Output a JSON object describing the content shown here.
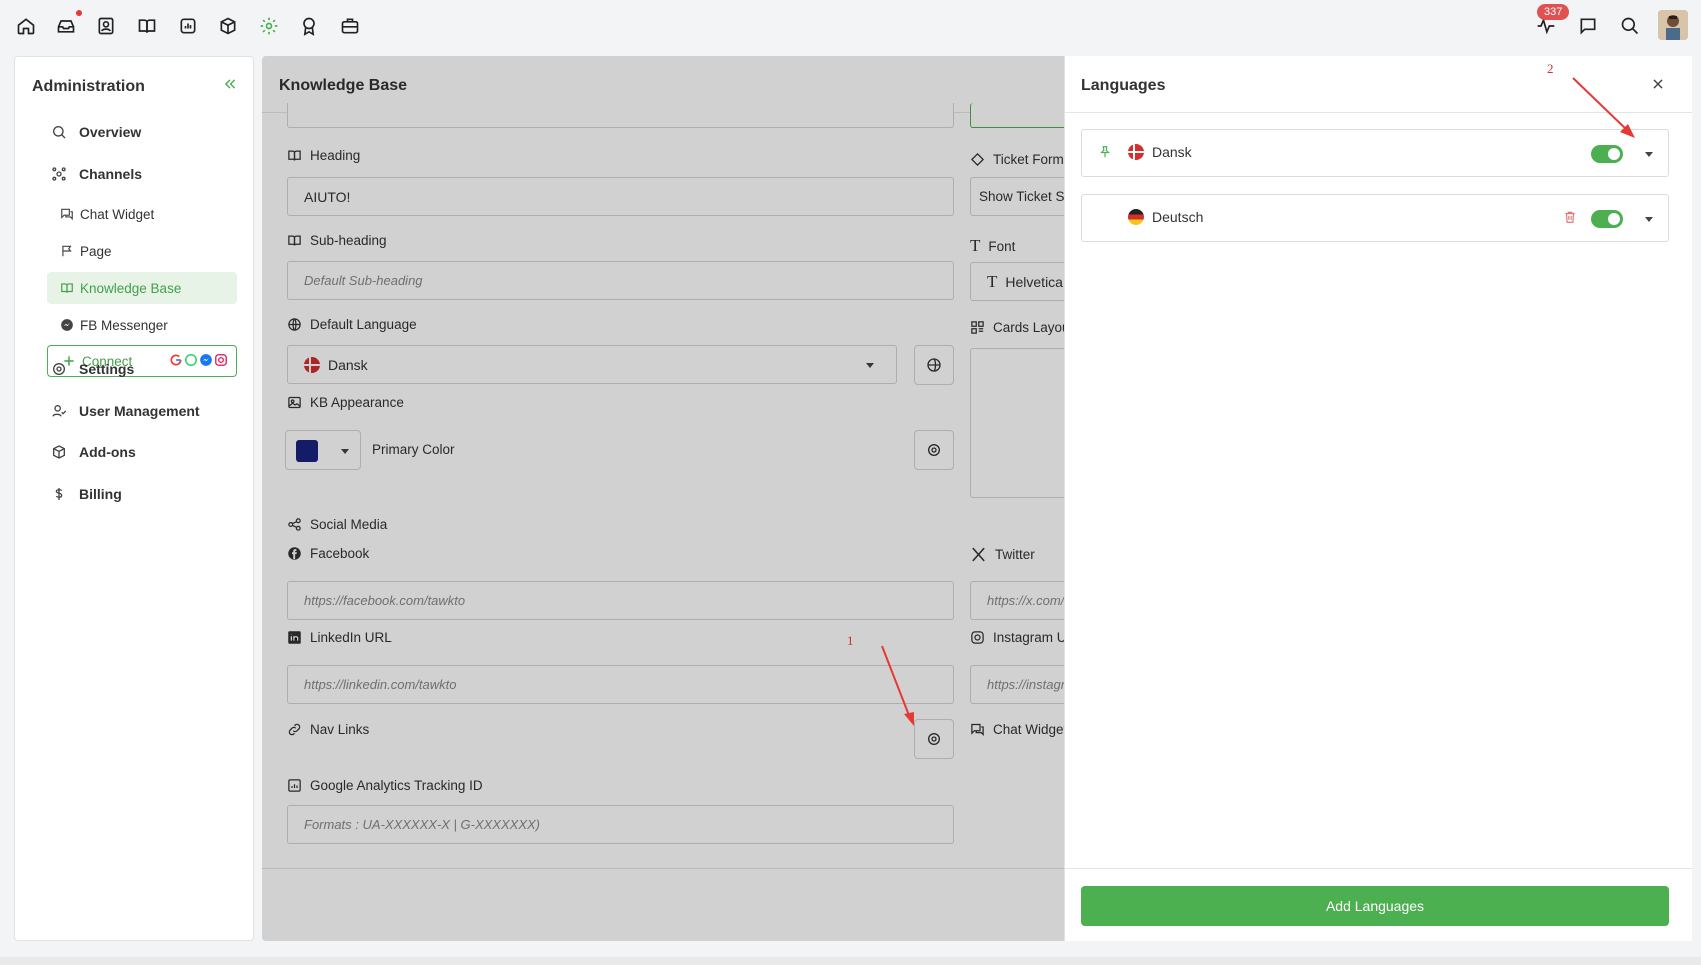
{
  "topbar": {
    "icons": [
      "home-icon",
      "inbox-icon",
      "contacts-icon",
      "knowledge-base-icon",
      "reports-icon",
      "addons-cube-icon",
      "settings-gear-icon",
      "award-icon",
      "briefcase-icon"
    ],
    "right_icons": [
      "activity-icon",
      "chat-icon",
      "search-icon"
    ],
    "activity_badge": "337",
    "active_color": "#4caf50"
  },
  "sidebar": {
    "title": "Administration",
    "items": [
      {
        "label": "Overview",
        "icon": "overview-icon"
      },
      {
        "label": "Channels",
        "icon": "channels-icon"
      },
      {
        "label": "Settings",
        "icon": "settings-icon"
      },
      {
        "label": "User Management",
        "icon": "user-management-icon"
      },
      {
        "label": "Add-ons",
        "icon": "addons-icon"
      },
      {
        "label": "Billing",
        "icon": "dollar-icon"
      }
    ],
    "channels": [
      {
        "label": "Chat Widget",
        "icon": "chat-widget-icon"
      },
      {
        "label": "Page",
        "icon": "flag-icon"
      },
      {
        "label": "Knowledge Base",
        "icon": "book-icon",
        "active": true
      },
      {
        "label": "FB Messenger",
        "icon": "messenger-icon"
      }
    ],
    "connect_label": "Connect"
  },
  "main": {
    "title": "Knowledge Base",
    "heading_label": "Heading",
    "heading_value": "AIUTO!",
    "subheading_label": "Sub-heading",
    "subheading_placeholder": "Default Sub-heading",
    "default_language_label": "Default Language",
    "default_language_value": "Dansk",
    "appearance_label": "KB Appearance",
    "primary_color_label": "Primary Color",
    "primary_color": "#1a237e",
    "social_label": "Social Media",
    "facebook_label": "Facebook",
    "facebook_placeholder": "https://facebook.com/tawkto",
    "linkedin_label": "LinkedIn URL",
    "linkedin_placeholder": "https://linkedin.com/tawkto",
    "navlinks_label": "Nav Links",
    "ga_label": "Google Analytics Tracking ID",
    "ga_placeholder": "Formats : UA-XXXXXX-X | G-XXXXXXX)",
    "ticket_form_label": "Ticket Form",
    "ticket_form_value": "Show Ticket Su",
    "font_label": "Font",
    "font_value": "Helvetica",
    "cards_layout_label": "Cards Layou",
    "twitter_label": "Twitter",
    "twitter_placeholder": "https://x.com/t",
    "instagram_label": "Instagram U",
    "instagram_placeholder": "https://instagra",
    "chat_widget_label": "Chat Widget"
  },
  "panel": {
    "title": "Languages",
    "languages": [
      {
        "name": "Dansk",
        "enabled": true,
        "default": true
      },
      {
        "name": "Deutsch",
        "enabled": true,
        "default": false
      }
    ],
    "add_button": "Add Languages"
  },
  "annotations": [
    "1",
    "2"
  ]
}
